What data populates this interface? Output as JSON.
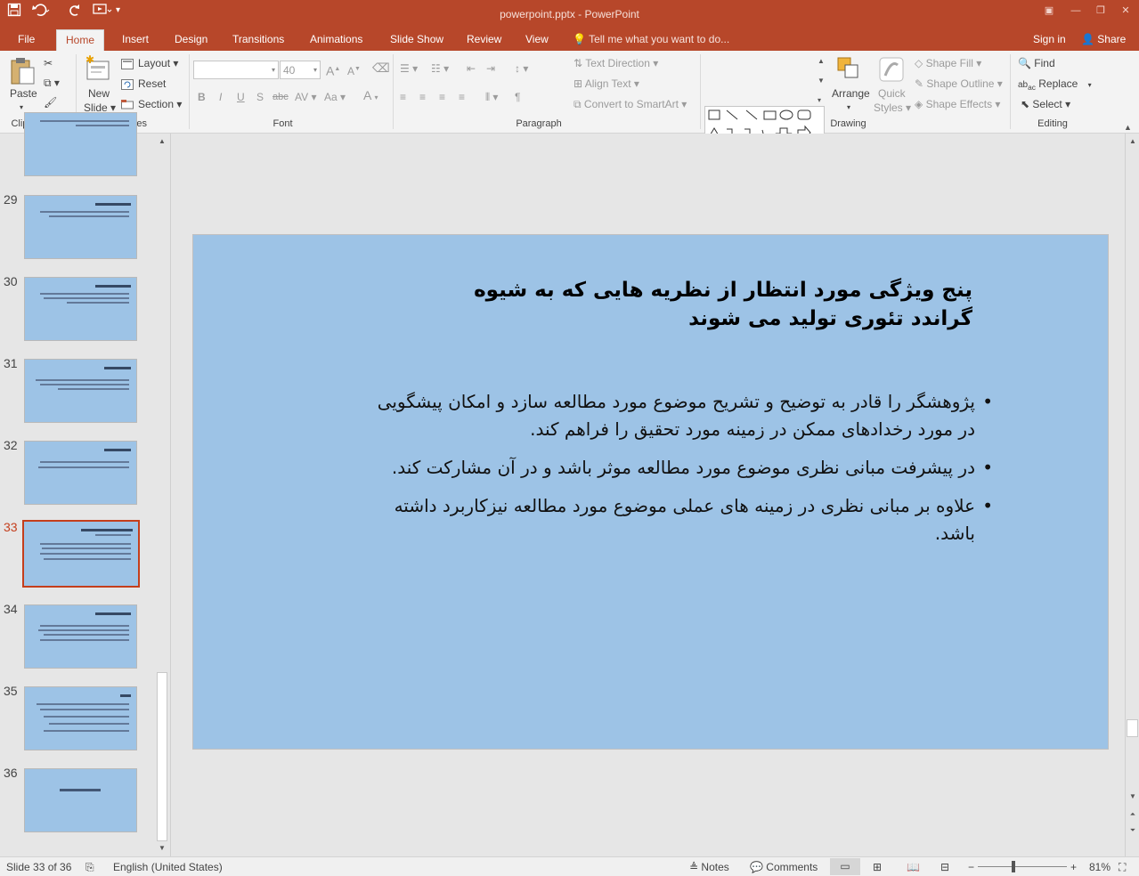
{
  "app": {
    "doc_title": "powerpoint.pptx - PowerPoint"
  },
  "tabs": [
    "File",
    "Home",
    "Insert",
    "Design",
    "Transitions",
    "Animations",
    "Slide Show",
    "Review",
    "View"
  ],
  "tell_me": "Tell me what you want to do...",
  "account": {
    "signin": "Sign in",
    "share": "Share"
  },
  "ribbon": {
    "clipboard": {
      "label": "Clipboard",
      "paste": "Paste"
    },
    "slides": {
      "label": "Slides",
      "new_slide": "New",
      "new_slide2": "Slide",
      "layout": "Layout",
      "reset": "Reset",
      "section": "Section"
    },
    "font": {
      "label": "Font",
      "size": "40"
    },
    "paragraph": {
      "label": "Paragraph",
      "text_direction": "Text Direction",
      "align_text": "Align Text",
      "convert_smartart": "Convert to SmartArt"
    },
    "drawing": {
      "label": "Drawing",
      "arrange": "Arrange",
      "quick_styles": "Quick",
      "quick_styles2": "Styles",
      "shape_fill": "Shape Fill",
      "shape_outline": "Shape Outline",
      "shape_effects": "Shape Effects"
    },
    "editing": {
      "label": "Editing",
      "find": "Find",
      "replace": "Replace",
      "select": "Select"
    }
  },
  "thumbnails": [
    {
      "num": "",
      "selected": false
    },
    {
      "num": "29",
      "selected": false
    },
    {
      "num": "30",
      "selected": false
    },
    {
      "num": "31",
      "selected": false
    },
    {
      "num": "32",
      "selected": false
    },
    {
      "num": "33",
      "selected": true
    },
    {
      "num": "34",
      "selected": false
    },
    {
      "num": "35",
      "selected": false
    },
    {
      "num": "36",
      "selected": false
    }
  ],
  "slide": {
    "title_line1": "پنج ویژگی مورد انتظار از نظریه هایی که به شیوه",
    "title_line2": "گراندد تئوری تولید می شوند",
    "bullets": [
      "پژوهشگر را قادر به توضیح و تشریح موضوع مورد مطالعه سازد و امکان پیشگویی در مورد رخدادهای ممکن در زمینه مورد تحقیق را فراهم کند.",
      "در پیشرفت مبانی نظری موضوع مورد مطالعه موثر باشد و در آن مشارکت کند.",
      "علاوه بر مبانی نظری در زمینه های عملی موضوع مورد مطالعه  نیزکاربرد داشته باشد."
    ]
  },
  "status": {
    "slide_info": "Slide 33 of 36",
    "language": "English (United States)",
    "notes": "Notes",
    "comments": "Comments",
    "zoom": "81%"
  },
  "colors": {
    "accent": "#b7472a",
    "slide_bg": "#9dc3e6",
    "selected_thumb": "#c43e1c"
  }
}
